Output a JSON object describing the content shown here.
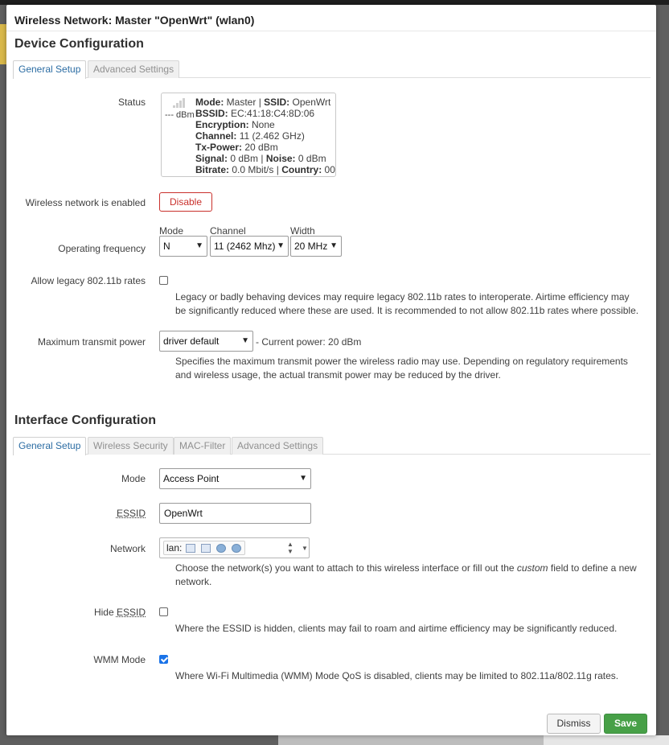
{
  "modal": {
    "title": "Wireless Network: Master \"OpenWrt\" (wlan0)"
  },
  "device_config": {
    "title": "Device Configuration",
    "tabs": [
      {
        "label": "General Setup",
        "active": true
      },
      {
        "label": "Advanced Settings",
        "active": false
      }
    ],
    "status": {
      "label": "Status",
      "dbm": "--- dBm",
      "mode_label": "Mode:",
      "mode_value": "Master",
      "ssid_label": "SSID:",
      "ssid_value": "OpenWrt",
      "bssid_label": "BSSID:",
      "bssid_value": "EC:41:18:C4:8D:06",
      "encryption_label": "Encryption:",
      "encryption_value": "None",
      "channel_label": "Channel:",
      "channel_value": "11 (2.462 GHz)",
      "txpower_label": "Tx-Power:",
      "txpower_value": "20 dBm",
      "signal_label": "Signal:",
      "signal_value": "0 dBm",
      "noise_label": "Noise:",
      "noise_value": "0 dBm",
      "bitrate_label": "Bitrate:",
      "bitrate_value": "0.0 Mbit/s",
      "country_label": "Country:",
      "country_value": "00",
      "separator": "|"
    },
    "enabled": {
      "label": "Wireless network is enabled",
      "button": "Disable"
    },
    "frequency": {
      "label": "Operating frequency",
      "mode_label": "Mode",
      "mode_value": "N",
      "channel_label": "Channel",
      "channel_value": "11 (2462 Mhz)",
      "width_label": "Width",
      "width_value": "20 MHz"
    },
    "legacy": {
      "label": "Allow legacy 802.11b rates",
      "checked": false,
      "description": "Legacy or badly behaving devices may require legacy 802.11b rates to interoperate. Airtime efficiency may be significantly reduced where these are used. It is recommended to not allow 802.11b rates where possible."
    },
    "txpower": {
      "label": "Maximum transmit power",
      "value": "driver default",
      "current": "- Current power: 20 dBm",
      "description": "Specifies the maximum transmit power the wireless radio may use. Depending on regulatory requirements and wireless usage, the actual transmit power may be reduced by the driver."
    }
  },
  "interface_config": {
    "title": "Interface Configuration",
    "tabs": [
      {
        "label": "General Setup",
        "active": true
      },
      {
        "label": "Wireless Security",
        "active": false
      },
      {
        "label": "MAC-Filter",
        "active": false
      },
      {
        "label": "Advanced Settings",
        "active": false
      }
    ],
    "mode": {
      "label": "Mode",
      "value": "Access Point"
    },
    "essid": {
      "label": "ESSID",
      "value": "OpenWrt"
    },
    "network": {
      "label": "Network",
      "value": "lan:",
      "description_pre": "Choose the network(s) you want to attach to this wireless interface or fill out the ",
      "description_em": "custom",
      "description_post": " field to define a new network."
    },
    "hide_essid": {
      "label_pre": "Hide ",
      "label_abbr": "ESSID",
      "checked": false,
      "description": "Where the ESSID is hidden, clients may fail to roam and airtime efficiency may be significantly reduced."
    },
    "wmm": {
      "label": "WMM Mode",
      "checked": true,
      "description": "Where Wi-Fi Multimedia (WMM) Mode QoS is disabled, clients may be limited to 802.11a/802.11g rates."
    }
  },
  "footer": {
    "dismiss": "Dismiss",
    "save": "Save"
  },
  "colors": {
    "accent_tab": "#2b6ca3",
    "danger": "#c9302c",
    "save_green": "#47a047",
    "checkbox_blue": "#1a73e8"
  },
  "icons": [
    "signal-icon",
    "chevron-down-icon",
    "ethernet-icon",
    "wifi-icon",
    "spinner-icon",
    "check-icon"
  ]
}
